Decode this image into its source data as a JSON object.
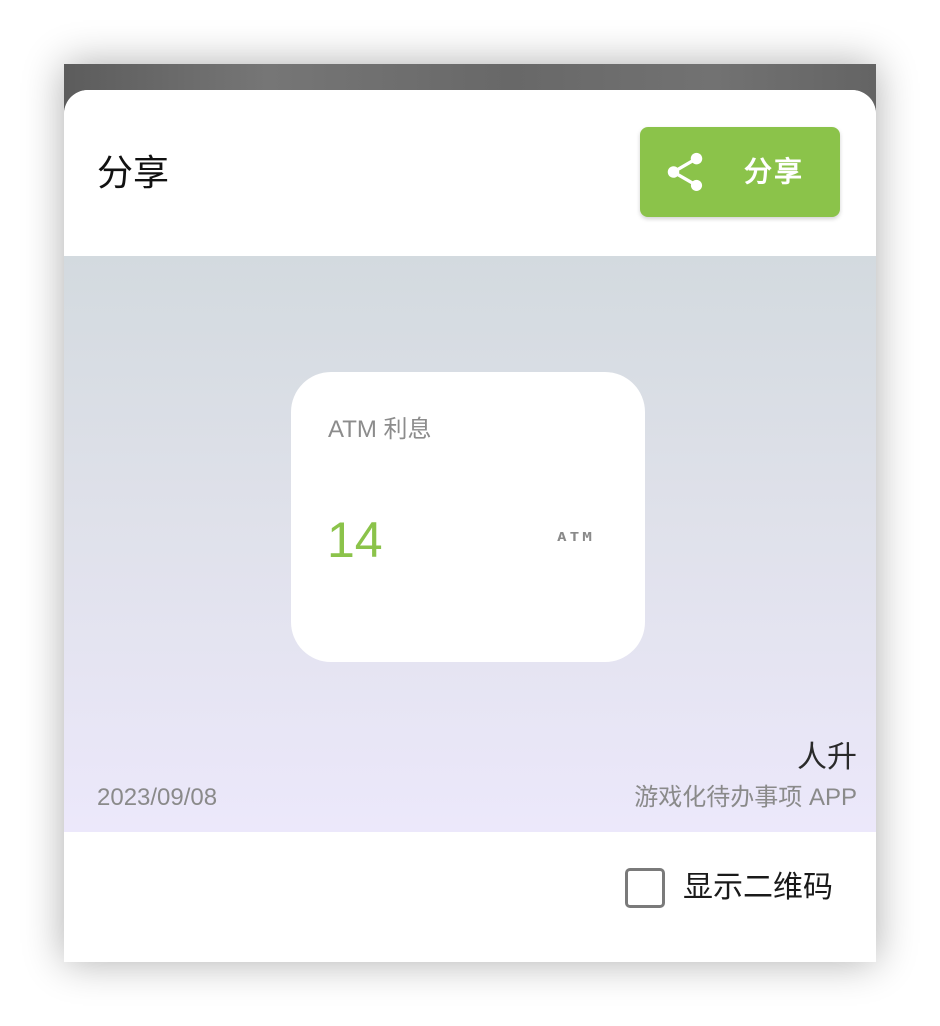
{
  "header": {
    "title": "分享",
    "share_button_label": "分享",
    "share_icon": "share-icon"
  },
  "card": {
    "title": "ATM 利息",
    "value": "14",
    "logo_text": "ATM"
  },
  "footer_info": {
    "date": "2023/09/08",
    "app_name": "人升",
    "app_tagline": "游戏化待办事项 APP"
  },
  "options": {
    "show_qr_label": "显示二维码",
    "show_qr_checked": false
  },
  "colors": {
    "accent": "#8BC34A",
    "preview_gradient_top": "#D3DADF",
    "preview_gradient_bottom": "#ECE8FB",
    "muted_text": "#8a8a8a"
  }
}
